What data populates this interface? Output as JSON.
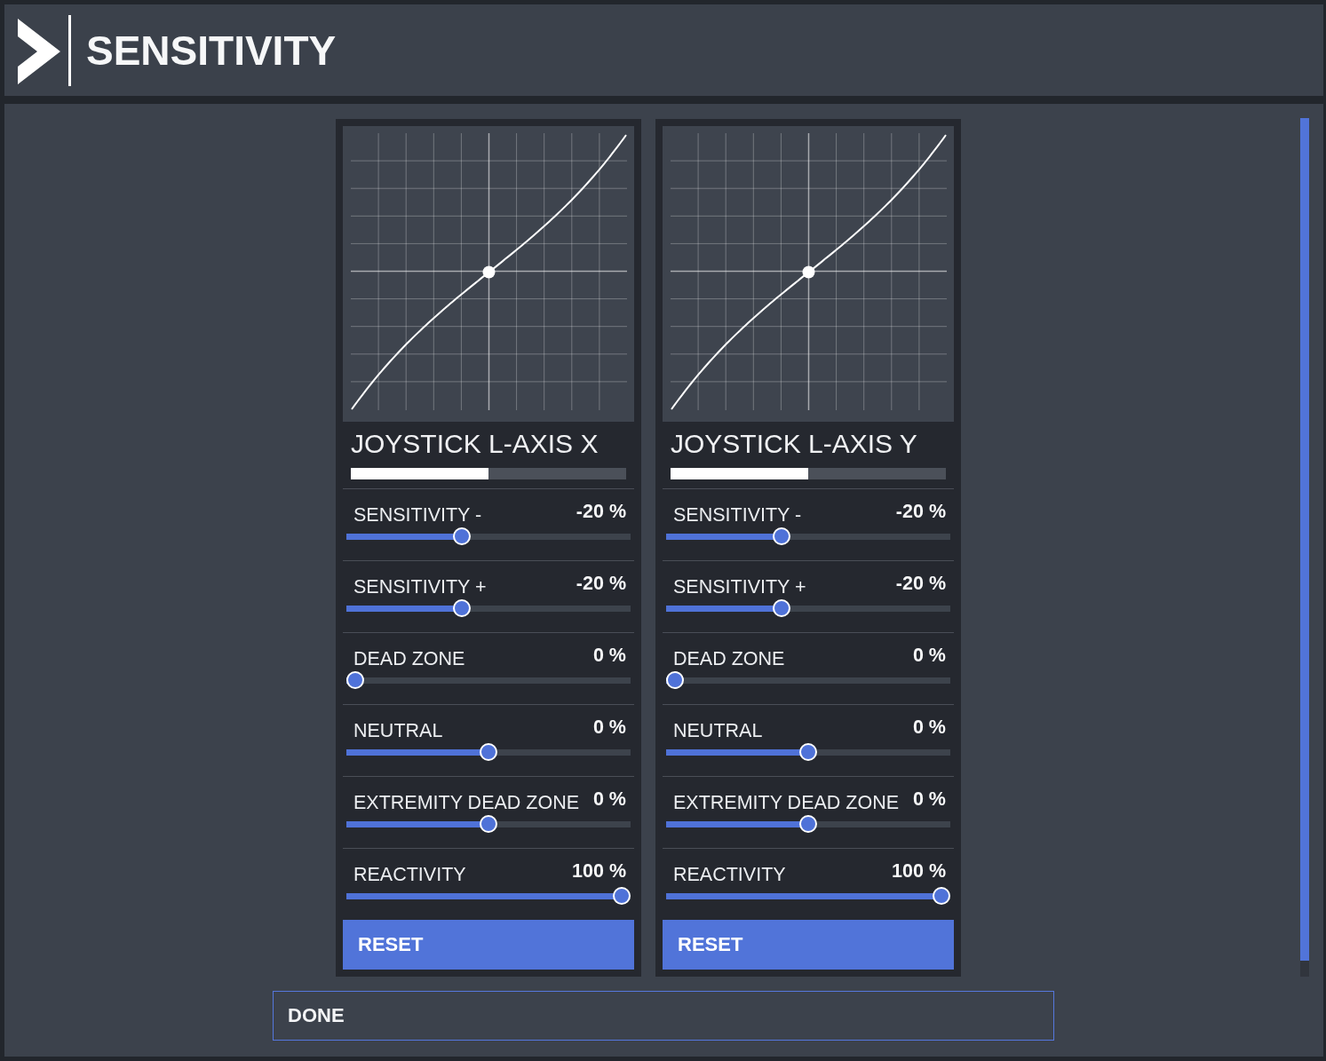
{
  "header": {
    "title": "SENSITIVITY"
  },
  "axes": [
    {
      "name": "JOYSTICK L-AXIS X",
      "level": 0.5,
      "settings": [
        {
          "label": "SENSITIVITY -",
          "value": "-20 %",
          "level": 0.4
        },
        {
          "label": "SENSITIVITY +",
          "value": "-20 %",
          "level": 0.4
        },
        {
          "label": "DEAD ZONE",
          "value": "0 %",
          "level": 0
        },
        {
          "label": "NEUTRAL",
          "value": "0 %",
          "level": 0.5
        },
        {
          "label": "EXTREMITY DEAD ZONE",
          "value": "0 %",
          "level": 0.5
        },
        {
          "label": "REACTIVITY",
          "value": "100 %",
          "level": 1
        }
      ],
      "reset_button": "RESET"
    },
    {
      "name": "JOYSTICK L-AXIS Y",
      "level": 0.5,
      "settings": [
        {
          "label": "SENSITIVITY -",
          "value": "-20 %",
          "level": 0.4
        },
        {
          "label": "SENSITIVITY +",
          "value": "-20 %",
          "level": 0.4
        },
        {
          "label": "DEAD ZONE",
          "value": "0 %",
          "level": 0
        },
        {
          "label": "NEUTRAL",
          "value": "0 %",
          "level": 0.5
        },
        {
          "label": "EXTREMITY DEAD ZONE",
          "value": "0 %",
          "level": 0.5
        },
        {
          "label": "REACTIVITY",
          "value": "100 %",
          "level": 1
        }
      ],
      "reset_button": "RESET"
    }
  ],
  "done_button": "DONE"
}
